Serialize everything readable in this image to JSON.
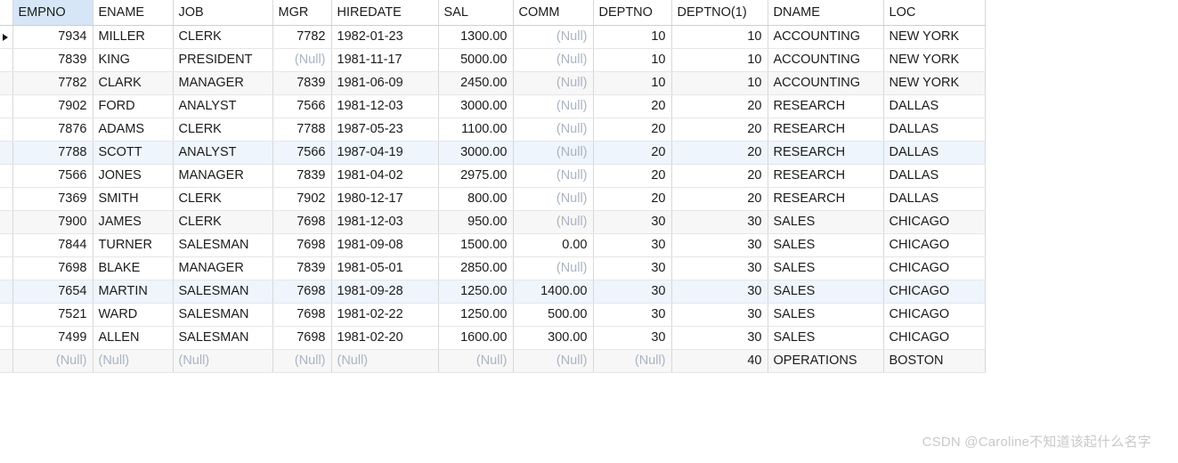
{
  "grid": {
    "selected_column": "EMPNO",
    "current_row_index": 0,
    "row_marker_icon": "triangle-right-icon",
    "null_label": "(Null)",
    "columns": [
      {
        "key": "EMPNO",
        "label": "EMPNO",
        "align": "num"
      },
      {
        "key": "ENAME",
        "label": "ENAME",
        "align": "txt"
      },
      {
        "key": "JOB",
        "label": "JOB",
        "align": "txt"
      },
      {
        "key": "MGR",
        "label": "MGR",
        "align": "num"
      },
      {
        "key": "HIREDATE",
        "label": "HIREDATE",
        "align": "txt"
      },
      {
        "key": "SAL",
        "label": "SAL",
        "align": "num"
      },
      {
        "key": "COMM",
        "label": "COMM",
        "align": "num"
      },
      {
        "key": "DEPTNO",
        "label": "DEPTNO",
        "align": "num"
      },
      {
        "key": "DEPTNO(1)",
        "label": "DEPTNO(1)",
        "align": "num"
      },
      {
        "key": "DNAME",
        "label": "DNAME",
        "align": "txt"
      },
      {
        "key": "LOC",
        "label": "LOC",
        "align": "txt"
      }
    ],
    "rows": [
      {
        "stripe": "white",
        "cells": [
          "7934",
          "MILLER",
          "CLERK",
          "7782",
          "1982-01-23",
          "1300.00",
          "(Null)",
          "10",
          "10",
          "ACCOUNTING",
          "NEW YORK"
        ]
      },
      {
        "stripe": "white",
        "cells": [
          "7839",
          "KING",
          "PRESIDENT",
          "(Null)",
          "1981-11-17",
          "5000.00",
          "(Null)",
          "10",
          "10",
          "ACCOUNTING",
          "NEW YORK"
        ]
      },
      {
        "stripe": "gray",
        "cells": [
          "7782",
          "CLARK",
          "MANAGER",
          "7839",
          "1981-06-09",
          "2450.00",
          "(Null)",
          "10",
          "10",
          "ACCOUNTING",
          "NEW YORK"
        ]
      },
      {
        "stripe": "white",
        "cells": [
          "7902",
          "FORD",
          "ANALYST",
          "7566",
          "1981-12-03",
          "3000.00",
          "(Null)",
          "20",
          "20",
          "RESEARCH",
          "DALLAS"
        ]
      },
      {
        "stripe": "white",
        "cells": [
          "7876",
          "ADAMS",
          "CLERK",
          "7788",
          "1987-05-23",
          "1100.00",
          "(Null)",
          "20",
          "20",
          "RESEARCH",
          "DALLAS"
        ]
      },
      {
        "stripe": "blue",
        "cells": [
          "7788",
          "SCOTT",
          "ANALYST",
          "7566",
          "1987-04-19",
          "3000.00",
          "(Null)",
          "20",
          "20",
          "RESEARCH",
          "DALLAS"
        ]
      },
      {
        "stripe": "white",
        "cells": [
          "7566",
          "JONES",
          "MANAGER",
          "7839",
          "1981-04-02",
          "2975.00",
          "(Null)",
          "20",
          "20",
          "RESEARCH",
          "DALLAS"
        ]
      },
      {
        "stripe": "white",
        "cells": [
          "7369",
          "SMITH",
          "CLERK",
          "7902",
          "1980-12-17",
          "800.00",
          "(Null)",
          "20",
          "20",
          "RESEARCH",
          "DALLAS"
        ]
      },
      {
        "stripe": "gray",
        "cells": [
          "7900",
          "JAMES",
          "CLERK",
          "7698",
          "1981-12-03",
          "950.00",
          "(Null)",
          "30",
          "30",
          "SALES",
          "CHICAGO"
        ]
      },
      {
        "stripe": "white",
        "cells": [
          "7844",
          "TURNER",
          "SALESMAN",
          "7698",
          "1981-09-08",
          "1500.00",
          "0.00",
          "30",
          "30",
          "SALES",
          "CHICAGO"
        ]
      },
      {
        "stripe": "white",
        "cells": [
          "7698",
          "BLAKE",
          "MANAGER",
          "7839",
          "1981-05-01",
          "2850.00",
          "(Null)",
          "30",
          "30",
          "SALES",
          "CHICAGO"
        ]
      },
      {
        "stripe": "blue",
        "cells": [
          "7654",
          "MARTIN",
          "SALESMAN",
          "7698",
          "1981-09-28",
          "1250.00",
          "1400.00",
          "30",
          "30",
          "SALES",
          "CHICAGO"
        ]
      },
      {
        "stripe": "white",
        "cells": [
          "7521",
          "WARD",
          "SALESMAN",
          "7698",
          "1981-02-22",
          "1250.00",
          "500.00",
          "30",
          "30",
          "SALES",
          "CHICAGO"
        ]
      },
      {
        "stripe": "white",
        "cells": [
          "7499",
          "ALLEN",
          "SALESMAN",
          "7698",
          "1981-02-20",
          "1600.00",
          "300.00",
          "30",
          "30",
          "SALES",
          "CHICAGO"
        ]
      },
      {
        "stripe": "gray",
        "cells": [
          "(Null)",
          "(Null)",
          "(Null)",
          "(Null)",
          "(Null)",
          "(Null)",
          "(Null)",
          "(Null)",
          "40",
          "OPERATIONS",
          "BOSTON"
        ]
      }
    ]
  },
  "watermark": {
    "text": "CSDN @Caroline不知道该起什么名字"
  },
  "colors": {
    "selected_header": "#d6e6f7",
    "stripe_gray": "#f7f7f7",
    "stripe_blue": "#eef5fc",
    "null_text": "#a9b4c2",
    "grid_line": "#d8d8d8",
    "watermark": "#c9c9c9"
  }
}
